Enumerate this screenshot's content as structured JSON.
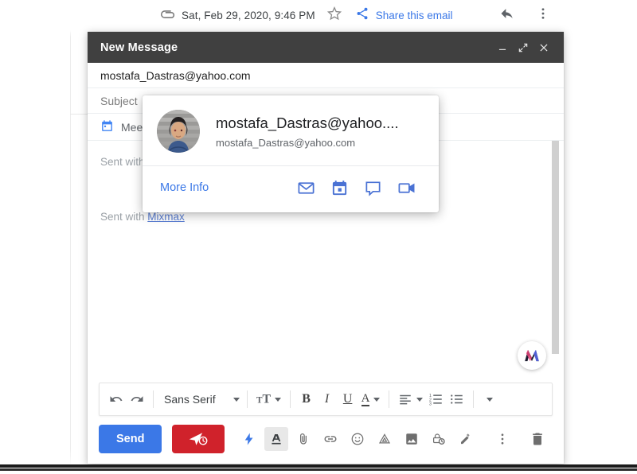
{
  "top_bar": {
    "attachment_icon": "paperclip-icon",
    "date": "Sat, Feb 29, 2020, 9:46 PM",
    "star_icon": "star-icon",
    "share_icon": "share-icon",
    "share_label": "Share this email",
    "reply_icon": "reply-icon",
    "more_icon": "kebab-menu-icon"
  },
  "compose": {
    "title": "New Message",
    "window_controls": {
      "minimize": "minimize-icon",
      "expand": "expand-icon",
      "close": "close-icon"
    },
    "to_value": "mostafa_Dastras@yahoo.com",
    "subject_placeholder": "Subject",
    "meet_label": "Meet",
    "body_lines": [
      {
        "prefix": "Sent with ",
        "link": "Mixmax"
      },
      {
        "prefix": "Sent with ",
        "link": "Mixmax"
      }
    ],
    "mixmax_badge": "mixmax-logo-icon",
    "format_toolbar": {
      "undo": "undo-icon",
      "redo": "redo-icon",
      "font_family": "Sans Serif",
      "font_size": "font-size-icon",
      "bold": "B",
      "italic": "I",
      "underline": "U",
      "text_color": "A",
      "align": "align-left-icon",
      "numbered_list": "numbered-list-icon",
      "bulleted_list": "bulleted-list-icon",
      "more": "more-format-options-icon"
    },
    "actions": {
      "send_label": "Send",
      "send_later": "send-later-icon",
      "instant_reply": "lightning-bolt-icon",
      "formatting": "formatting-options-icon",
      "attach": "attach-file-icon",
      "link": "insert-link-icon",
      "emoji": "insert-emoji-icon",
      "drive": "insert-drive-file-icon",
      "photo": "insert-photo-icon",
      "confidential": "confidential-mode-icon",
      "signature": "signature-icon",
      "more_options": "more-options-icon",
      "discard": "discard-draft-icon"
    }
  },
  "contact_card": {
    "avatar": "contact-avatar",
    "name": "mostafa_Dastras@yahoo....",
    "email": "mostafa_Dastras@yahoo.com",
    "more_info_label": "More Info",
    "actions": {
      "email": "email-icon",
      "calendar": "calendar-icon",
      "chat": "chat-icon",
      "video": "video-call-icon"
    }
  },
  "colors": {
    "accent_blue": "#3b78e7",
    "send_later_red": "#d0222b",
    "header_dark": "#404040",
    "link_blue": "#5b7fd4",
    "card_icon_blue": "#4a72d4"
  }
}
